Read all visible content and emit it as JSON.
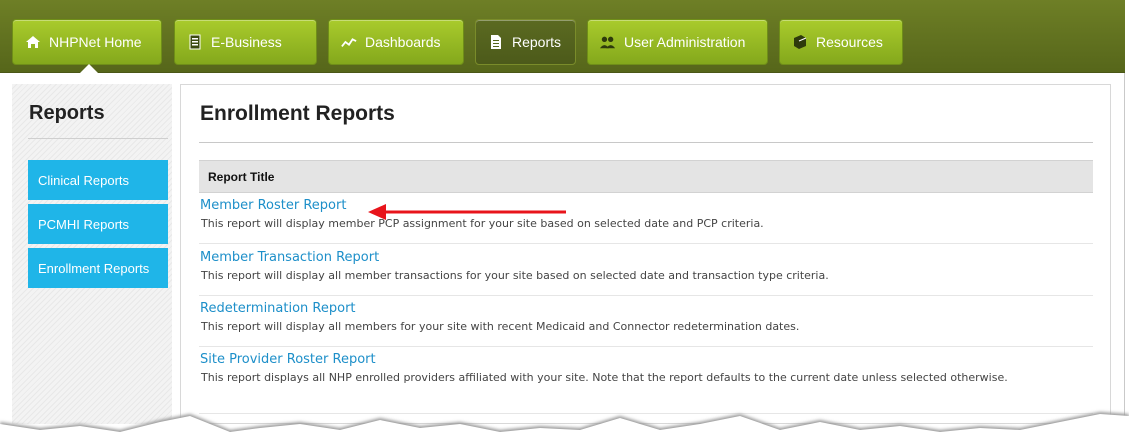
{
  "nav": {
    "items": [
      {
        "label": "NHPNet Home",
        "icon": "home-icon"
      },
      {
        "label": "E-Business",
        "icon": "document-icon"
      },
      {
        "label": "Dashboards",
        "icon": "chart-icon"
      },
      {
        "label": "Reports",
        "icon": "report-icon"
      },
      {
        "label": "User Administration",
        "icon": "users-icon"
      },
      {
        "label": "Resources",
        "icon": "book-icon"
      }
    ]
  },
  "sidebar": {
    "title": "Reports",
    "items": [
      {
        "label": "Clinical Reports"
      },
      {
        "label": "PCMHI Reports"
      },
      {
        "label": "Enrollment Reports"
      }
    ]
  },
  "main": {
    "title": "Enrollment Reports",
    "table_header": "Report Title",
    "reports": [
      {
        "title": "Member Roster Report",
        "description": "This report will display member PCP assignment for your site based on selected date and PCP criteria."
      },
      {
        "title": "Member Transaction Report",
        "description": "This report will display all member transactions for your site based on selected date and transaction type criteria."
      },
      {
        "title": "Redetermination Report",
        "description": "This report will display all members for your site with recent Medicaid and Connector redetermination dates."
      },
      {
        "title": "Site Provider Roster Report",
        "description": "This report displays all NHP enrolled providers affiliated with your site. Note that the report defaults to the current date unless selected otherwise."
      }
    ]
  },
  "colors": {
    "nav_bg": "#5f701f",
    "nav_button": "#9bbf27",
    "sidebar_item": "#1fb5e8",
    "link": "#1d8fc9",
    "arrow": "#e8141b"
  }
}
